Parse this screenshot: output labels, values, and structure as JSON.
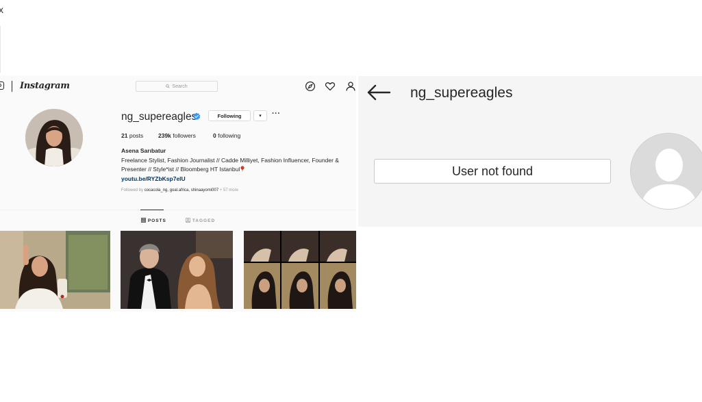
{
  "corner_mark": "x",
  "instagram": {
    "wordmark": "Instagram",
    "search_placeholder": "Search",
    "nav_icons": [
      "compass-icon",
      "heart-icon",
      "profile-icon"
    ],
    "profile": {
      "username": "ng_supereagles",
      "verified": true,
      "follow_button": "Following",
      "dropdown_caret": "▾",
      "more": "···",
      "posts_count": "21",
      "posts_label": "posts",
      "followers_count": "239k",
      "followers_label": "followers",
      "following_count": "0",
      "following_label": "following",
      "full_name": "Asena Sarıbatur",
      "bio": "Freelance Stylist, Fashion Journalist // Cadde Milliyet, Fashion Influencer, Founder & Presenter // Style*ist // Bloomberg HT Istanbul",
      "link": "youtu.be/RYZbKsp7elU",
      "followed_by_prefix": "Followed by",
      "followed_by_names": "cocacola_ng, goal.africa, shinaayomi007",
      "followed_by_more": "+ 57 more"
    },
    "tabs": {
      "posts": "POSTS",
      "tagged": "TAGGED"
    },
    "accent_link_color": "#003569",
    "verified_color": "#3897f0"
  },
  "mobile": {
    "username": "ng_supereagles",
    "message": "User not found"
  }
}
